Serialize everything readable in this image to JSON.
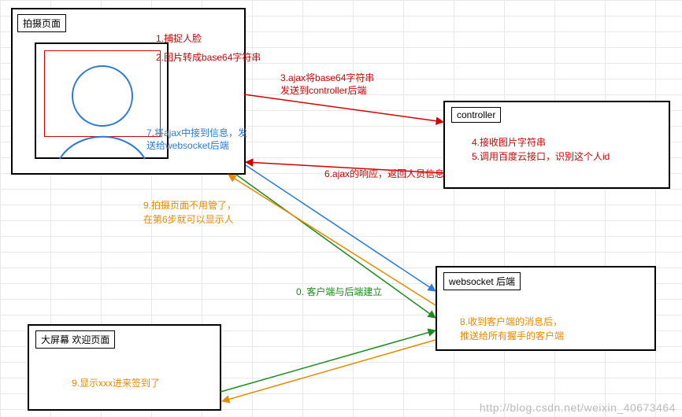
{
  "boxes": {
    "capture": {
      "title": "拍摄页面"
    },
    "controller": {
      "title": "controller"
    },
    "websocket": {
      "title": "websocket 后端"
    },
    "welcome": {
      "title": "大屏幕 欢迎页面"
    }
  },
  "annotations": {
    "step0": "0.  客户端与后端建立",
    "step1": "1.捕捉人脸",
    "step2": "2.图片转成base64字符串",
    "step3a": "3.ajax将base64字符串",
    "step3b": "发送到controller后端",
    "step4": "4.接收图片字符串",
    "step5": "5.调用百度云接口，识别这个人id",
    "step6": "6.ajax的响应，返回人员信息",
    "step7a": "7.将ajax中接到信息，发",
    "step7b": "送给websocket后端",
    "step8a": "8.收到客户端的消息后，",
    "step8b": "推送给所有握手的客户端",
    "step9a": "9.拍摄页面不用管了，",
    "step9b": "在第6步就可以显示人",
    "step9c": "9.显示xxx进来签到了"
  },
  "watermark": "http://blog.csdn.net/weixin_40673464"
}
